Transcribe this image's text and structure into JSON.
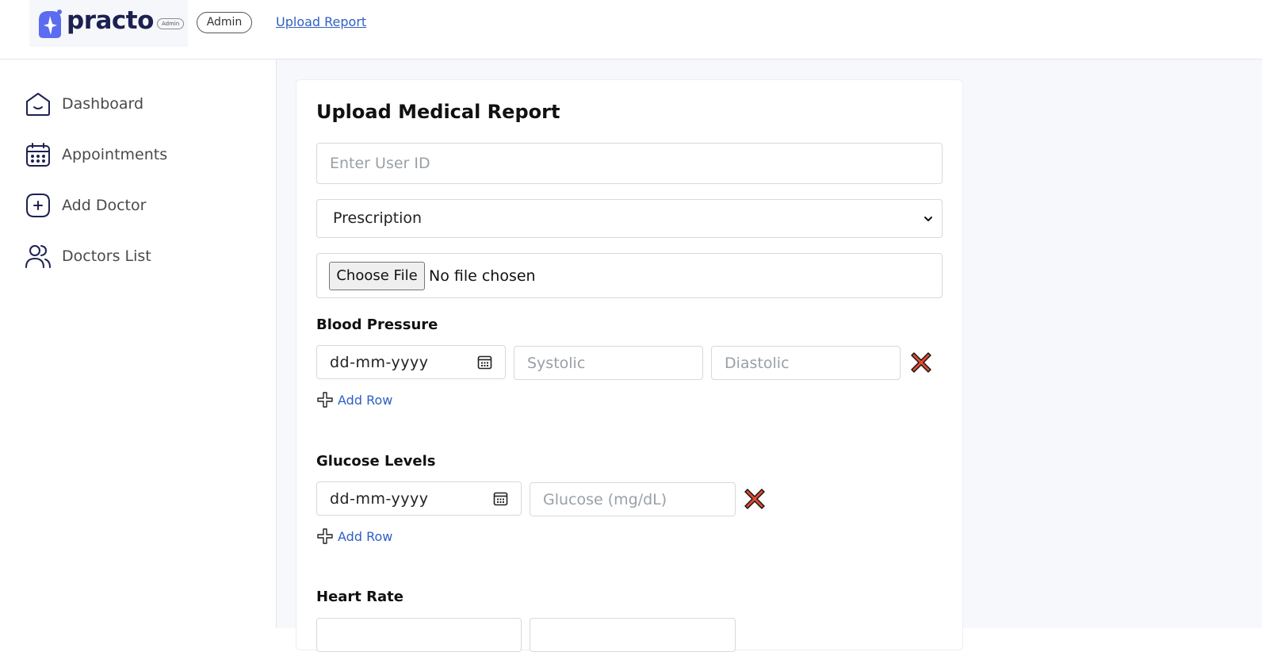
{
  "header": {
    "logo_text": "practo",
    "logo_badge": "Admin",
    "role_label": "Admin",
    "link_label": "Upload Report"
  },
  "sidebar": {
    "items": [
      {
        "label": "Dashboard",
        "icon": "home-icon"
      },
      {
        "label": "Appointments",
        "icon": "calendar-icon"
      },
      {
        "label": "Add Doctor",
        "icon": "add-icon"
      },
      {
        "label": "Doctors List",
        "icon": "people-icon"
      }
    ]
  },
  "form": {
    "title": "Upload Medical Report",
    "user_id_placeholder": "Enter User ID",
    "report_type_selected": "Prescription",
    "file_button_label": "Choose File",
    "file_status": "No file chosen",
    "blood_pressure": {
      "label": "Blood Pressure",
      "date_placeholder": "dd-mm-yyyy",
      "systolic_placeholder": "Systolic",
      "diastolic_placeholder": "Diastolic",
      "add_row_label": "Add Row"
    },
    "glucose": {
      "label": "Glucose Levels",
      "date_placeholder": "dd-mm-yyyy",
      "glucose_placeholder": "Glucose (mg/dL)",
      "add_row_label": "Add Row"
    },
    "heart_rate": {
      "label": "Heart Rate"
    }
  },
  "colors": {
    "brand_navy": "#1d2150",
    "brand_blue": "#5b6cf0",
    "link_blue": "#2f5fc4",
    "remove_red": "#e04a32"
  }
}
